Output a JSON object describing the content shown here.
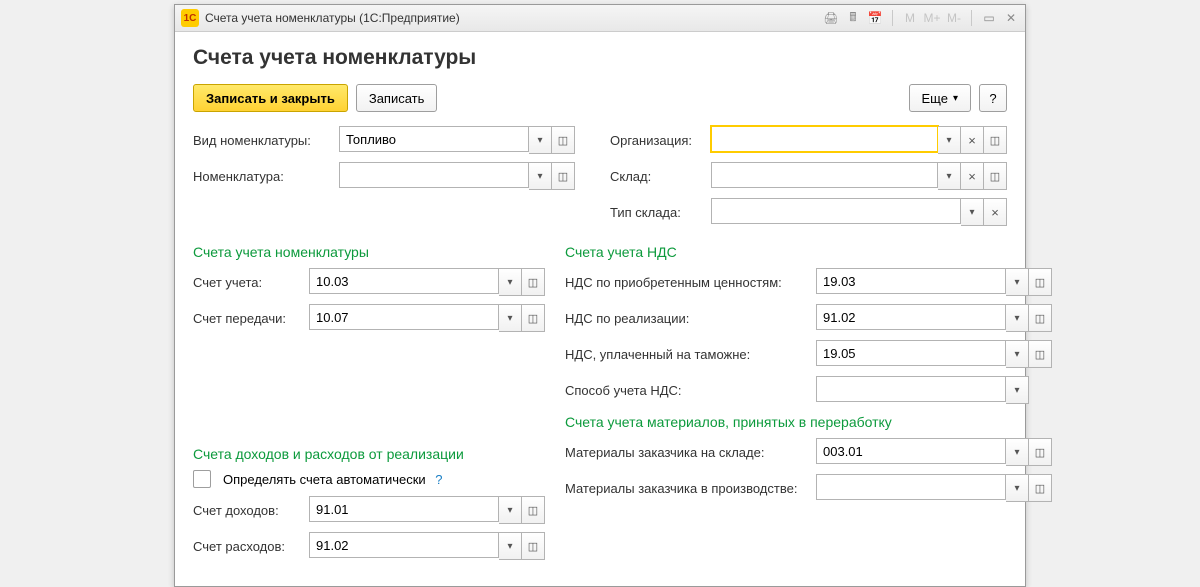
{
  "window": {
    "title": "Счета учета номенклатуры  (1С:Предприятие)",
    "logo_text": "1C"
  },
  "page_title": "Счета учета номенклатуры",
  "toolbar": {
    "save_close": "Записать и закрыть",
    "save": "Записать",
    "more": "Еще",
    "help": "?"
  },
  "top_left": {
    "kind_label": "Вид номенклатуры:",
    "kind_value": "Топливо",
    "nomenclature_label": "Номенклатура:",
    "nomenclature_value": ""
  },
  "top_right": {
    "org_label": "Организация:",
    "org_value": "",
    "warehouse_label": "Склад:",
    "warehouse_value": "",
    "warehouse_type_label": "Тип склада:",
    "warehouse_type_value": ""
  },
  "sec1": {
    "title": "Счета учета номенклатуры",
    "acct_label": "Счет учета:",
    "acct_value": "10.03",
    "transfer_label": "Счет передачи:",
    "transfer_value": "10.07"
  },
  "sec2": {
    "title": "Счета учета НДС",
    "vat_purchase_label": "НДС по приобретенным ценностям:",
    "vat_purchase_value": "19.03",
    "vat_sales_label": "НДС по реализации:",
    "vat_sales_value": "91.02",
    "vat_customs_label": "НДС, уплаченный на таможне:",
    "vat_customs_value": "19.05",
    "vat_method_label": "Способ учета НДС:",
    "vat_method_value": ""
  },
  "sec3": {
    "title": "Счета доходов и расходов от реализации",
    "auto_label": "Определять счета автоматически",
    "income_label": "Счет доходов:",
    "income_value": "91.01",
    "expense_label": "Счет расходов:",
    "expense_value": "91.02"
  },
  "sec4": {
    "title": "Счета учета материалов, принятых в переработку",
    "mat_stock_label": "Материалы заказчика на складе:",
    "mat_stock_value": "003.01",
    "mat_prod_label": "Материалы заказчика в производстве:",
    "mat_prod_value": ""
  },
  "titlebar_mem": {
    "m": "M",
    "mplus": "M+",
    "mminus": "M-"
  }
}
